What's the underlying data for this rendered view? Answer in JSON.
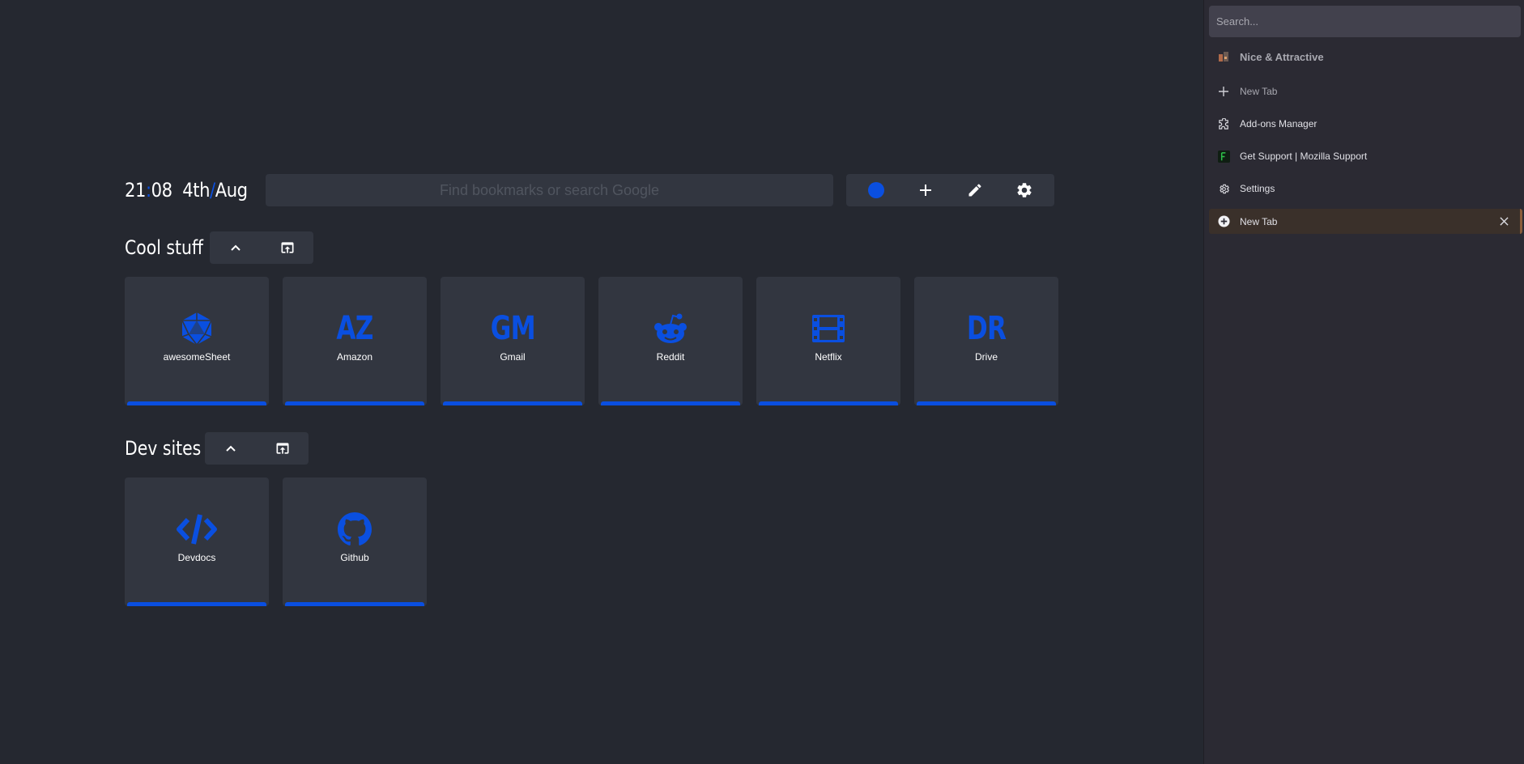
{
  "colors": {
    "accent": "#0a4fe0",
    "background": "#252830",
    "card": "#323640",
    "sidebar": "#2b2a33"
  },
  "clock": {
    "hours": "21",
    "colon": ":",
    "minutes": "08",
    "day": "4th",
    "slash": "/",
    "month": "Aug"
  },
  "search": {
    "placeholder": "Find bookmarks or search Google"
  },
  "toolbar": {
    "theme_icon": "blue-dot-icon",
    "add_icon": "plus-icon",
    "edit_icon": "pencil-icon",
    "settings_icon": "gear-icon"
  },
  "groups": [
    {
      "title": "Cool stuff",
      "collapse_icon": "chevron-up-icon",
      "open_all_icon": "open-in-new-icon",
      "bookmarks": [
        {
          "label": "awesomeSheet",
          "icon": "d20-icon"
        },
        {
          "label": "Amazon",
          "letters": "AZ"
        },
        {
          "label": "Gmail",
          "letters": "GM"
        },
        {
          "label": "Reddit",
          "icon": "reddit-icon"
        },
        {
          "label": "Netflix",
          "icon": "film-icon"
        },
        {
          "label": "Drive",
          "letters": "DR"
        }
      ]
    },
    {
      "title": "Dev sites",
      "collapse_icon": "chevron-up-icon",
      "open_all_icon": "open-in-new-icon",
      "bookmarks": [
        {
          "label": "Devdocs",
          "icon": "code-icon"
        },
        {
          "label": "Github",
          "icon": "github-icon"
        }
      ]
    }
  ],
  "sidebar": {
    "search_placeholder": "Search...",
    "items": [
      {
        "label": "Nice & Attractive",
        "icon": "tab-group-icon"
      },
      {
        "label": "New Tab",
        "icon": "plus-icon"
      },
      {
        "label": "Add-ons Manager",
        "icon": "puzzle-icon"
      },
      {
        "label": "Get Support | Mozilla Support",
        "icon": "mozilla-support-icon"
      },
      {
        "label": "Settings",
        "icon": "gear-icon"
      },
      {
        "label": "New Tab",
        "icon": "plus-circle-icon"
      }
    ]
  }
}
